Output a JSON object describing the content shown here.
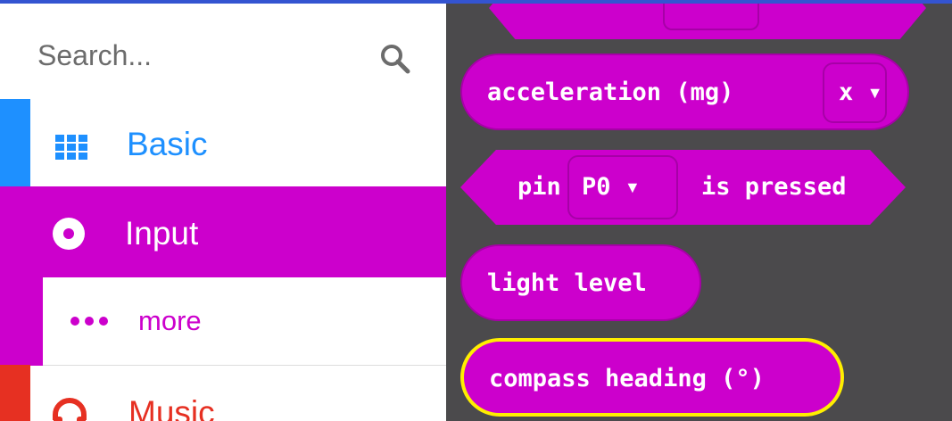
{
  "search": {
    "placeholder": "Search..."
  },
  "categories": [
    {
      "label": "Basic",
      "color": "#1e90ff",
      "icon": "grid-icon"
    },
    {
      "label": "Input",
      "color": "#cc00cc",
      "icon": "target-icon",
      "selected": true
    },
    {
      "label": "more",
      "color": "#cc00cc",
      "icon": "dots-icon"
    },
    {
      "label": "Music",
      "color": "#e63022",
      "icon": "headphones-icon"
    }
  ],
  "blocks": {
    "acceleration": {
      "text": "acceleration (mg)",
      "dropdown": "x ▾"
    },
    "pin_pressed": {
      "prefix": "pin",
      "dropdown": "P0 ▾",
      "suffix": "is pressed"
    },
    "light_level": {
      "text": "light level"
    },
    "compass_heading": {
      "text": "compass heading (°)"
    }
  },
  "colors": {
    "input": "#cc00cc",
    "workspace": "#4b4a4c",
    "highlight": "#ffee00"
  }
}
